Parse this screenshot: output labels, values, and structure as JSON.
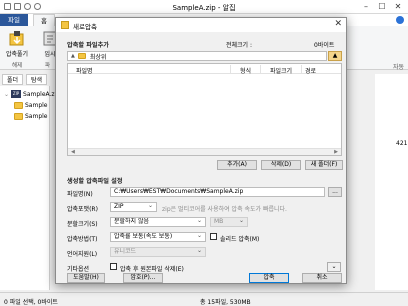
{
  "app": {
    "title": "SampleA.zip - 알집",
    "tabs": {
      "file": "파일",
      "home": "홈"
    },
    "ribbon": {
      "compress_label": "압축풀기",
      "compress_sub": "해제",
      "temp_label": "임시",
      "temp_sub": "파",
      "tail": "자동"
    },
    "panel_tabs": {
      "folder": "폴더",
      "search": "탐색"
    },
    "tree": {
      "root": "SampleA.z",
      "child1": "Sample",
      "child2": "Sample"
    },
    "right_value": "421",
    "status": {
      "left": "0 파일 선택, 0바이트",
      "right": "총 15파일, 530MB"
    }
  },
  "dialog": {
    "title": "새로압축",
    "add_files_label": "압축할 파일추가",
    "total_size_label": "전체크기 :",
    "total_size_value": "0바이트",
    "path_text": "최상위",
    "path_button": "▲",
    "columns": [
      "파일명",
      "형식",
      "파일크기",
      "경로"
    ],
    "buttons": {
      "add": "추가(A)",
      "delete": "삭제(D)",
      "new_folder": "새 폴더(F)"
    },
    "settings_label": "생성할 압축파일 설정",
    "filename_label": "파일명(N)",
    "filename_value": "C:₩Users₩EST₩Documents₩SampleA.zip",
    "browse_button": "...",
    "format_label": "압축포맷(R)",
    "format_value": "ZIP",
    "format_desc": "zip은 멀티코어를 사용하여 압축 속도가 빠릅니다.",
    "split_label": "분할크기(S)",
    "split_value": "분할하지 않음",
    "split_unit": "MB",
    "method_label": "압축방법(T)",
    "method_value": "압축률 보통(속도 보통)",
    "solid_label": "솔리드 압축(M)",
    "lang_label": "언어지원(L)",
    "lang_value": "유니코드",
    "other_label": "기타옵션",
    "delete_original_label": "압축 후 원본파일 삭제(E)",
    "help_button": "도움말(H)",
    "password_button": "암호(P)...",
    "ok_button": "압축",
    "cancel_button": "취소"
  }
}
